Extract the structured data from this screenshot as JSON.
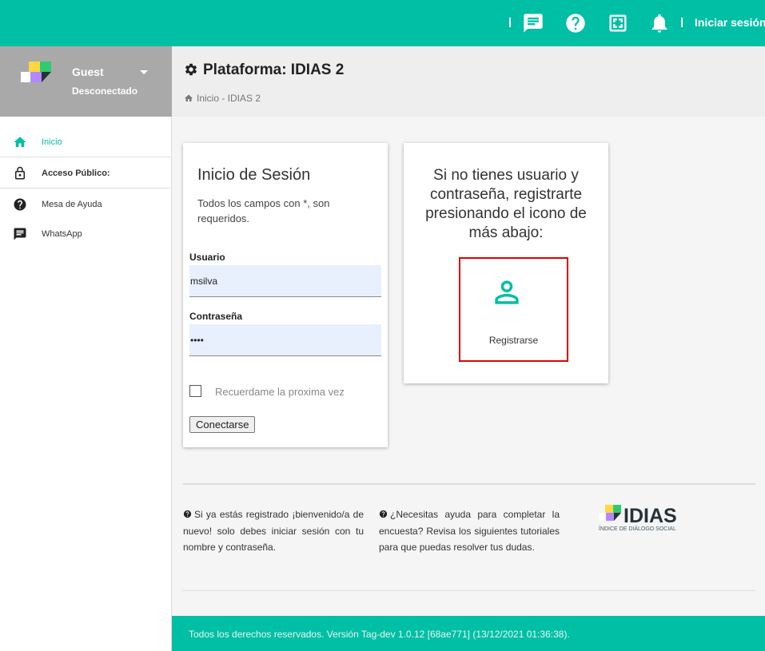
{
  "topbar": {
    "icons": [
      "chat-icon",
      "help-icon",
      "fullscreen-icon",
      "bell-icon"
    ],
    "login_label": "Iniciar sesión",
    "color": "#00bfa5"
  },
  "user": {
    "name": "Guest",
    "status": "Desconectado"
  },
  "sidebar": {
    "items": [
      {
        "label": "Inicio",
        "icon": "home-icon",
        "active": true
      },
      {
        "label": "Acceso Público:",
        "icon": "lock-icon"
      },
      {
        "label": "Mesa de Ayuda",
        "icon": "help-icon"
      },
      {
        "label": "WhatsApp",
        "icon": "chat-icon"
      }
    ]
  },
  "header": {
    "title": "Plataforma: IDIAS 2",
    "breadcrumb": "Inicio - IDIAS 2"
  },
  "login": {
    "title": "Inicio de Sesión",
    "note": "Todos los campos con *, son requeridos.",
    "user_label": "Usuario",
    "user_value": "msilva",
    "pass_label": "Contraseña",
    "pass_value": "••••",
    "remember_label": "Recuerdame la proxima vez",
    "submit_label": "Conectarse"
  },
  "register": {
    "message": "Si no tienes usuario y contraseña, registrarte presionando el icono de más abajo:",
    "button_label": "Registrarse",
    "icon": "person-icon"
  },
  "info": {
    "left": "Si ya estás registrado ¡bienvenido/a de nuevo! solo debes iniciar sesión con tu nombre y contraseña.",
    "right": "¿Necesitas ayuda para completar la encuesta? Revisa los siguientes tutoriales para que puedas resolver tus dudas."
  },
  "brand": {
    "name": "IDIAS",
    "tagline": "ÍNDICE DE DIÁLOGO SOCIAL"
  },
  "footer": {
    "text": "Todos los derechos reservados. Versión Tag-dev 1.0.12 [68ae771] (13/12/2021 01:36:38)."
  },
  "colors": {
    "accent": "#00bfa5",
    "highlight_border": "#e00000",
    "input_bg": "#e8f0fe"
  }
}
